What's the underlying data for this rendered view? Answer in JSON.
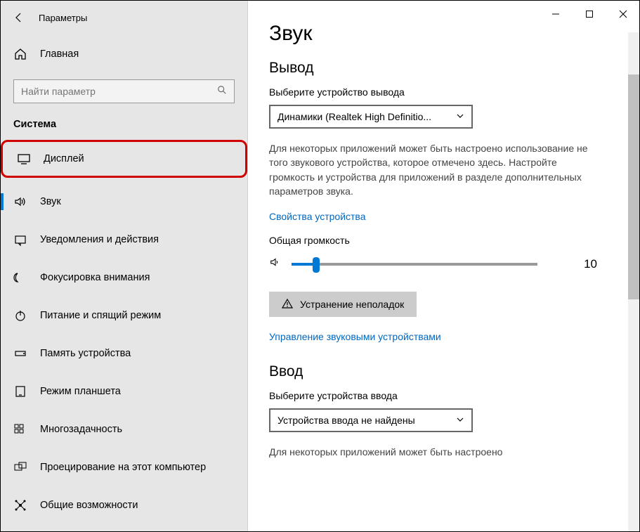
{
  "titlebar": {
    "title": "Параметры"
  },
  "home_label": "Главная",
  "search": {
    "placeholder": "Найти параметр"
  },
  "section": "Система",
  "nav": [
    {
      "label": "Дисплей",
      "icon": "display"
    },
    {
      "label": "Звук",
      "icon": "sound"
    },
    {
      "label": "Уведомления и действия",
      "icon": "notifications"
    },
    {
      "label": "Фокусировка внимания",
      "icon": "focus"
    },
    {
      "label": "Питание и спящий режим",
      "icon": "power"
    },
    {
      "label": "Память устройства",
      "icon": "storage"
    },
    {
      "label": "Режим планшета",
      "icon": "tablet"
    },
    {
      "label": "Многозадачность",
      "icon": "multitask"
    },
    {
      "label": "Проецирование на этот компьютер",
      "icon": "project"
    },
    {
      "label": "Общие возможности",
      "icon": "shared"
    }
  ],
  "page": {
    "title": "Звук",
    "output": {
      "heading": "Вывод",
      "select_label": "Выберите устройство вывода",
      "device": "Динамики (Realtek High Definitio...",
      "help": "Для некоторых приложений может быть настроено использование не того звукового устройства, которое отмечено здесь. Настройте громкость и устройства для приложений в разделе дополнительных параметров звука.",
      "props_link": "Свойства устройства",
      "volume_label": "Общая громкость",
      "volume_value": "10",
      "troubleshoot": "Устранение неполадок",
      "manage_link": "Управление звуковыми устройствами"
    },
    "input": {
      "heading": "Ввод",
      "select_label": "Выберите устройства ввода",
      "device": "Устройства ввода не найдены",
      "help": "Для некоторых приложений может быть настроено"
    }
  }
}
